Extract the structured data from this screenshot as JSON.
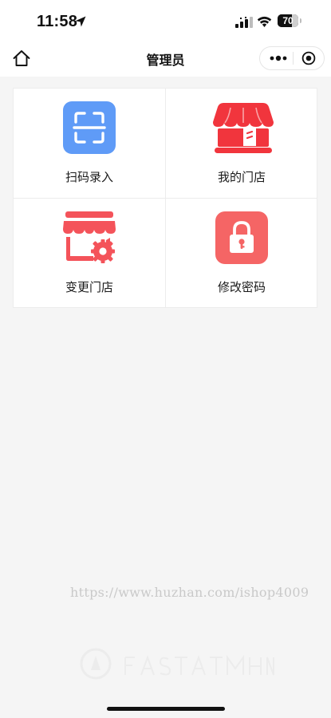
{
  "status_bar": {
    "time": "11:58",
    "battery_level": 70,
    "battery_text": "70"
  },
  "nav_bar": {
    "title": "管理员"
  },
  "menu": {
    "items": [
      {
        "label": "扫码录入",
        "icon": "scan-icon",
        "color": "#5f9bf7"
      },
      {
        "label": "我的门店",
        "icon": "store-icon",
        "color": "#f1353d"
      },
      {
        "label": "变更门店",
        "icon": "store-settings-icon",
        "color": "#f4535a"
      },
      {
        "label": "修改密码",
        "icon": "lock-icon",
        "color": "#f56565"
      }
    ]
  },
  "watermark": {
    "url": "https://www.huzhan.com/ishop4009"
  },
  "colors": {
    "background": "#f5f5f5",
    "surface": "#ffffff",
    "divider": "#ececec"
  }
}
